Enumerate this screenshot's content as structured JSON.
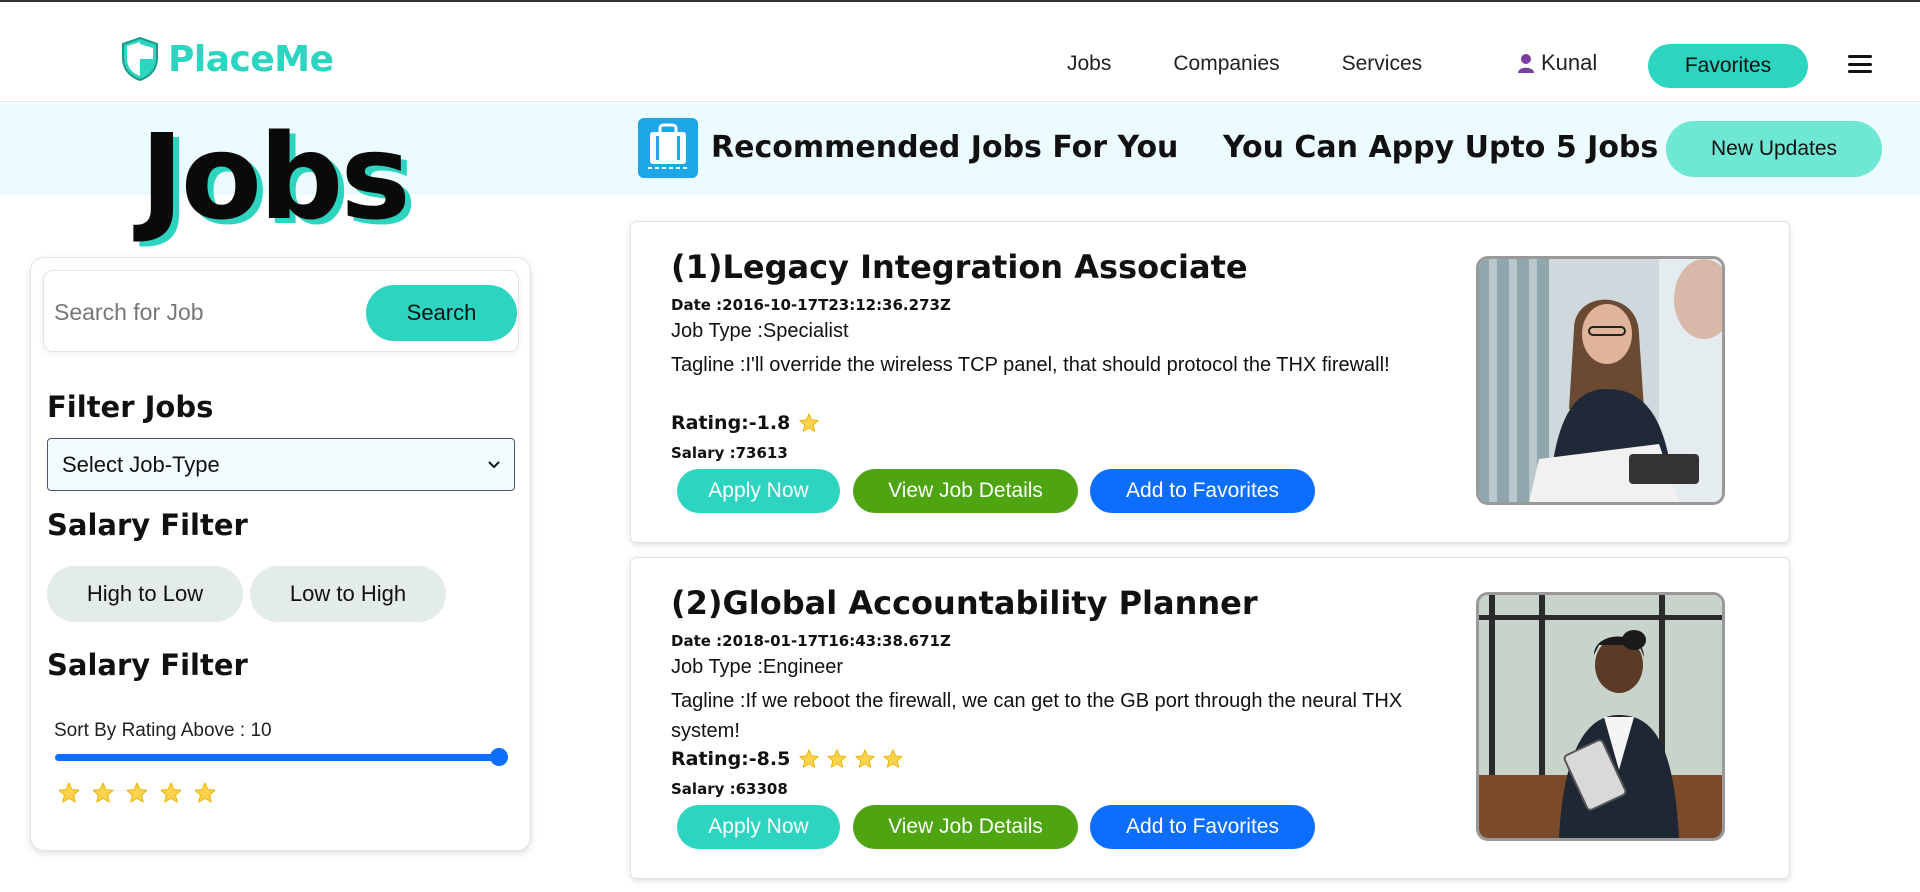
{
  "navbar": {
    "brand": "PlaceMe",
    "links": [
      "Jobs",
      "Companies",
      "Services"
    ],
    "user": "Kunal",
    "favorites_label": "Favorites"
  },
  "banner": {
    "page_title": "Jobs",
    "recommended": "Recommended Jobs For You",
    "apply_limit": "You Can Appy Upto 5 Jobs !",
    "updates_label": "New Updates"
  },
  "sidebar": {
    "search_placeholder": "Search for Job",
    "search_label": "Search",
    "filter_heading": "Filter Jobs",
    "select_value": "Select Job-Type",
    "salary_heading": "Salary Filter",
    "high_to_low": "High to Low",
    "low_to_high": "Low to High",
    "salary_heading_2": "Salary Filter",
    "rating_label": "Sort By Rating Above : 10",
    "rating_value": 10,
    "rating_max": 10,
    "stars": 5
  },
  "jobs": [
    {
      "title": "(1)Legacy Integration Associate",
      "date": "Date :2016-10-17T23:12:36.273Z",
      "type": "Job Type :Specialist",
      "tagline": "Tagline :I'll override the wireless TCP panel, that should protocol the THX firewall!",
      "rating": "Rating:-1.8",
      "stars": 1,
      "salary": "Salary :73613",
      "apply_label": "Apply Now",
      "view_label": "View Job Details",
      "fav_label": "Add to Favorites"
    },
    {
      "title": "(2)Global Accountability Planner",
      "date": "Date :2018-01-17T16:43:38.671Z",
      "type": "Job Type :Engineer",
      "tagline": "Tagline :If we reboot the firewall, we can get to the GB port through the neural THX system!",
      "rating": "Rating:-8.5",
      "stars": 4,
      "salary": "Salary :63308",
      "apply_label": "Apply Now",
      "view_label": "View Job Details",
      "fav_label": "Add to Favorites"
    }
  ],
  "colors": {
    "accent": "#2dd4bf",
    "blue": "#0d6efd",
    "green": "#4ea511",
    "star": "#fcd34d"
  }
}
